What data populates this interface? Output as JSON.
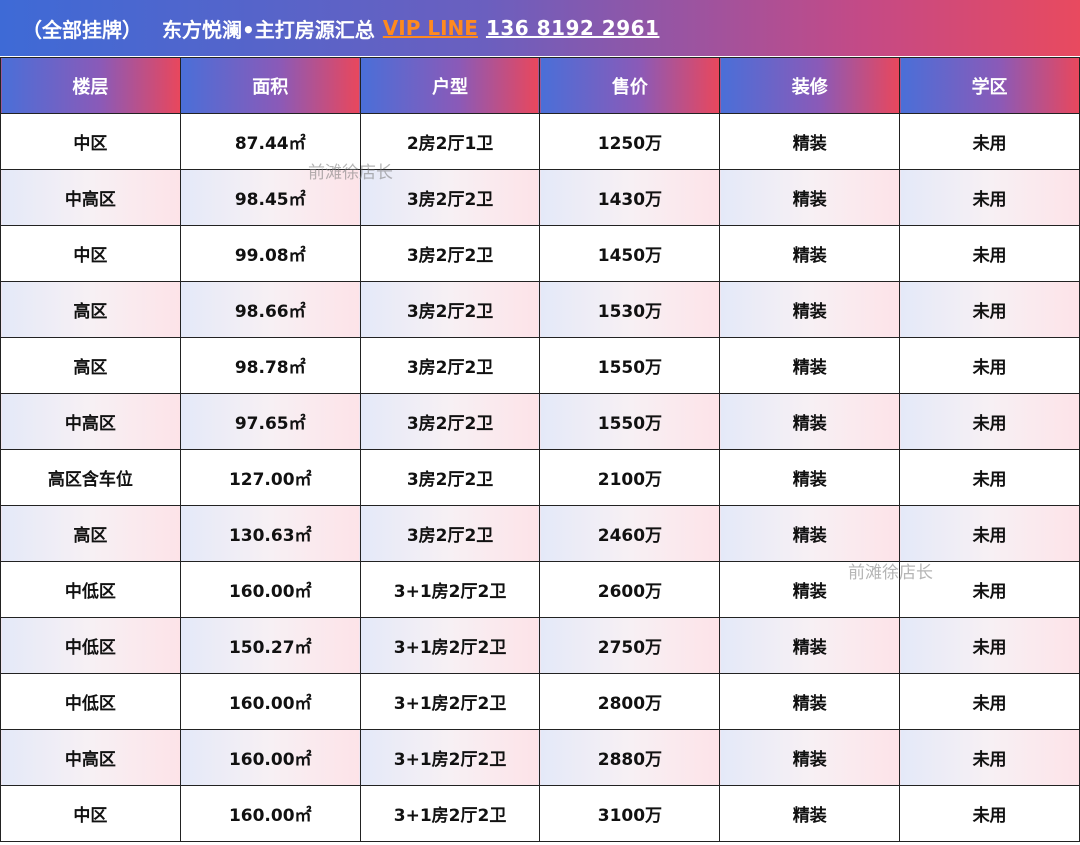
{
  "header": {
    "tag": "（全部挂牌）",
    "title": "东方悦澜•主打房源汇总",
    "vip": "VIP LINE",
    "phone": "136 8192 2961"
  },
  "columns": [
    "楼层",
    "面积",
    "户型",
    "售价",
    "装修",
    "学区"
  ],
  "rows": [
    [
      "中区",
      "87.44㎡",
      "2房2厅1卫",
      "1250万",
      "精装",
      "未用"
    ],
    [
      "中高区",
      "98.45㎡",
      "3房2厅2卫",
      "1430万",
      "精装",
      "未用"
    ],
    [
      "中区",
      "99.08㎡",
      "3房2厅2卫",
      "1450万",
      "精装",
      "未用"
    ],
    [
      "高区",
      "98.66㎡",
      "3房2厅2卫",
      "1530万",
      "精装",
      "未用"
    ],
    [
      "高区",
      "98.78㎡",
      "3房2厅2卫",
      "1550万",
      "精装",
      "未用"
    ],
    [
      "中高区",
      "97.65㎡",
      "3房2厅2卫",
      "1550万",
      "精装",
      "未用"
    ],
    [
      "高区含车位",
      "127.00㎡",
      "3房2厅2卫",
      "2100万",
      "精装",
      "未用"
    ],
    [
      "高区",
      "130.63㎡",
      "3房2厅2卫",
      "2460万",
      "精装",
      "未用"
    ],
    [
      "中低区",
      "160.00㎡",
      "3+1房2厅2卫",
      "2600万",
      "精装",
      "未用"
    ],
    [
      "中低区",
      "150.27㎡",
      "3+1房2厅2卫",
      "2750万",
      "精装",
      "未用"
    ],
    [
      "中低区",
      "160.00㎡",
      "3+1房2厅2卫",
      "2800万",
      "精装",
      "未用"
    ],
    [
      "中高区",
      "160.00㎡",
      "3+1房2厅2卫",
      "2880万",
      "精装",
      "未用"
    ],
    [
      "中区",
      "160.00㎡",
      "3+1房2厅2卫",
      "3100万",
      "精装",
      "未用"
    ]
  ],
  "watermarks": [
    "前滩徐店长",
    "前滩徐店长"
  ],
  "colors": {
    "accent_blue": "#3e6ad6",
    "accent_red": "#e84a5f",
    "vip_orange": "#ff8a1e"
  }
}
